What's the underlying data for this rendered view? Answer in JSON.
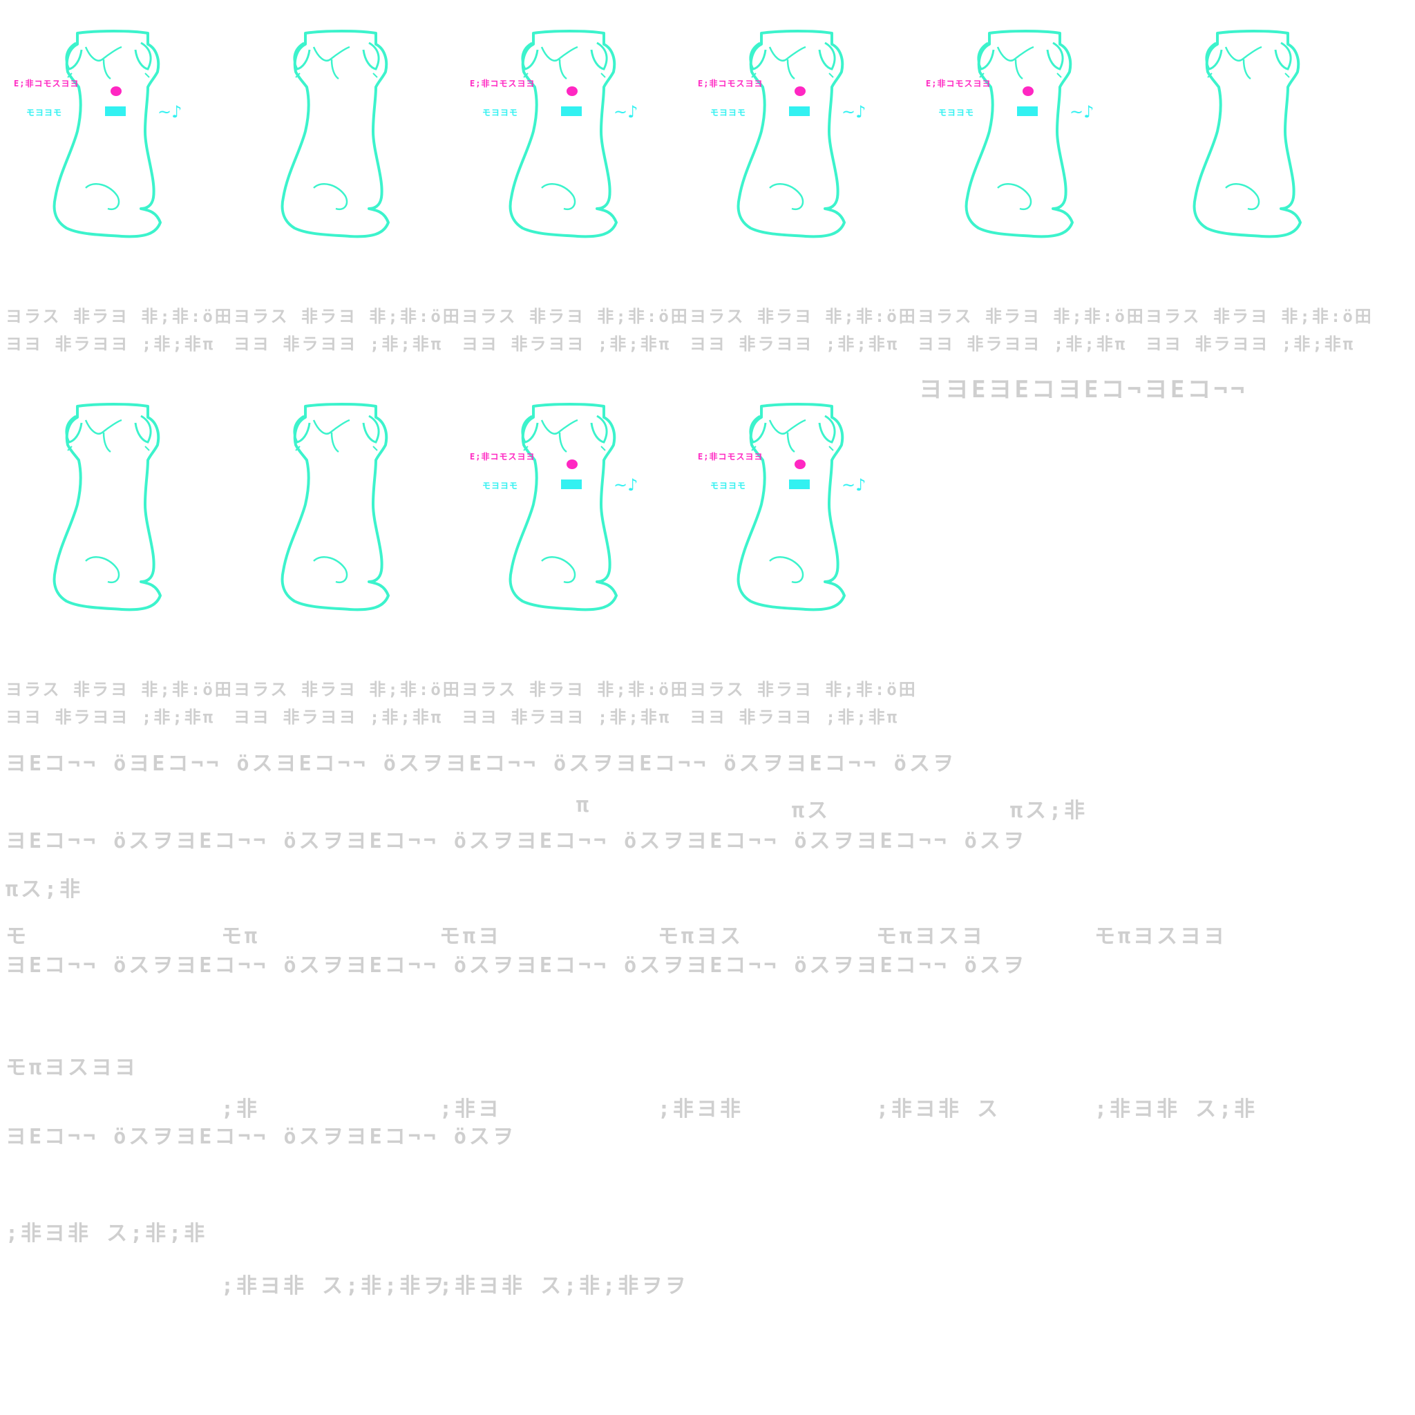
{
  "frames": [
    {
      "state": "on",
      "line1": "ヨラス 非ラヨ 非;非:ö田",
      "line2": "ヨヨ 非ラヨヨ ;非;非π",
      "tag_pink": "E;非コモスヨヨ",
      "tag_cyan": "モヨヨモ"
    },
    {
      "state": "off",
      "line1": "ヨラス 非ラヨ 非;非:ö田",
      "line2": "ヨヨ 非ラヨヨ ;非;非π"
    },
    {
      "state": "on",
      "line1": "ヨラス 非ラヨ 非;非:ö田",
      "line2": "ヨヨ 非ラヨヨ ;非;非π",
      "tag_pink": "E;非コモスヨヨ",
      "tag_cyan": "モヨヨモ"
    },
    {
      "state": "on",
      "line1": "ヨラス 非ラヨ 非;非:ö田",
      "line2": "ヨヨ 非ラヨヨ ;非;非π",
      "tag_pink": "E;非コモスヨヨ",
      "tag_cyan": "モヨヨモ"
    },
    {
      "state": "on",
      "line1": "ヨラス 非ラヨ 非;非:ö田",
      "line2": "ヨヨ 非ラヨヨ ;非;非π",
      "tag_pink": "E;非コモスヨヨ",
      "tag_cyan": "モヨヨモ"
    },
    {
      "state": "off",
      "line1": "ヨラス 非ラヨ 非;非:ö田",
      "line2": "ヨヨ 非ラヨヨ ;非;非π"
    },
    {
      "state": "off",
      "line1": "ヨラス 非ラヨ 非;非:ö田",
      "line2": "ヨヨ 非ラヨヨ ;非;非π"
    },
    {
      "state": "off",
      "line1": "ヨラス 非ラヨ 非;非:ö田",
      "line2": "ヨヨ 非ラヨヨ ;非;非π"
    },
    {
      "state": "on",
      "line1": "ヨラス 非ラヨ 非;非:ö田",
      "line2": "ヨヨ 非ラヨヨ ;非;非π",
      "tag_pink": "E;非コモスヨヨ",
      "tag_cyan": "モヨヨモ"
    },
    {
      "state": "on",
      "line1": "ヨラス 非ラヨ 非;非:ö田",
      "line2": "ヨヨ 非ラヨヨ ;非;非π",
      "tag_pink": "E;非コモスヨヨ",
      "tag_cyan": "モヨヨモ"
    }
  ],
  "sequence_label": "ヨヨEヨEコヨEコ¬ヨEコ¬¬",
  "rows": [
    "ヨEコ¬¬ öヨEコ¬¬ öスヨEコ¬¬ öスヲヨEコ¬¬ öスヲヨEコ¬¬ öスヲヨEコ¬¬ öスヲ",
    "π",
    "πス",
    "πス;非",
    "ヨEコ¬¬ öスヲヨEコ¬¬ öスヲヨEコ¬¬ öスヲヨEコ¬¬ öスヲヨEコ¬¬ öスヲヨEコ¬¬ öスヲ",
    "πス;非",
    "モ",
    "モπ",
    "モπヨ",
    "モπヨス",
    "モπヨスヨ",
    "モπヨスヨヨ",
    "ヨEコ¬¬ öスヲヨEコ¬¬ öスヲヨEコ¬¬ öスヲヨEコ¬¬ öスヲヨEコ¬¬ öスヲヨEコ¬¬ öスヲ",
    "モπヨスヨヨ",
    ";非",
    ";非ヨ",
    ";非ヨ非",
    ";非ヨ非 ス",
    ";非ヨ非 ス;非",
    "ヨEコ¬¬ öスヲヨEコ¬¬ öスヲヨEコ¬¬ öスヲ",
    ";非ヨ非 ス;非;非",
    ";非ヨ非 ス;非;非ヲ",
    ";非ヨ非 ス;非;非ヲヲ"
  ],
  "colors": {
    "outline": "#3cf3cc",
    "accent_pink": "#ff27c2",
    "accent_cyan": "#32f1f1",
    "text_grey": "#cfcfcf"
  }
}
